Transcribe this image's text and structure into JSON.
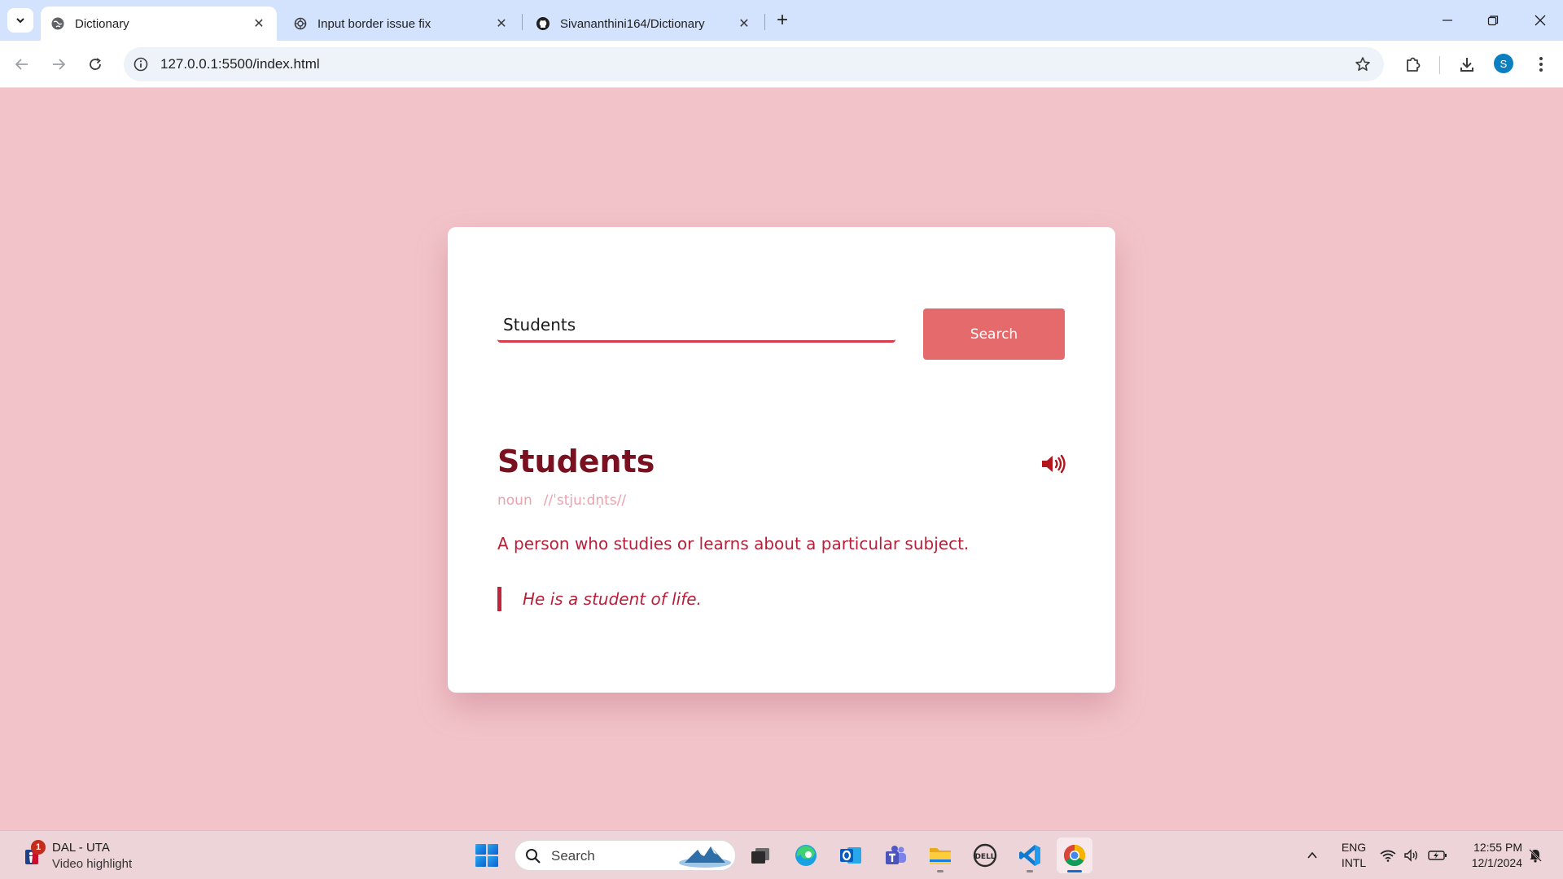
{
  "browser": {
    "tabs": [
      {
        "title": "Dictionary",
        "favicon": "globe-icon",
        "active": true
      },
      {
        "title": "Input border issue fix",
        "favicon": "openai-icon",
        "active": false
      },
      {
        "title": "Sivananthini164/Dictionary",
        "favicon": "github-icon",
        "active": false
      }
    ],
    "url": "127.0.0.1:5500/index.html",
    "profile_initial": "S"
  },
  "app": {
    "input_value": "Students",
    "search_label": "Search",
    "word": "Students",
    "part_of_speech": "noun",
    "phonetic": "//ˈstjuːdn̩ts//",
    "definition": "A person who studies or learns about a particular subject.",
    "example": "He is a student of life.",
    "colors": {
      "page_background": "#f2c4ca",
      "accent": "#e46a6b",
      "word": "#7a1120",
      "text": "#b8203a",
      "meta": "#eda0ad"
    }
  },
  "taskbar": {
    "news": {
      "badge": "1",
      "title": "DAL - UTA",
      "subtitle": "Video highlight"
    },
    "search_placeholder": "Search",
    "apps": [
      "windows-start-icon",
      "task-view-icon",
      "edge-icon",
      "outlook-icon",
      "teams-icon",
      "file-explorer-icon",
      "dell-icon",
      "vscode-icon",
      "chrome-icon"
    ],
    "language": {
      "line1": "ENG",
      "line2": "INTL"
    },
    "time": "12:55 PM",
    "date": "12/1/2024"
  }
}
